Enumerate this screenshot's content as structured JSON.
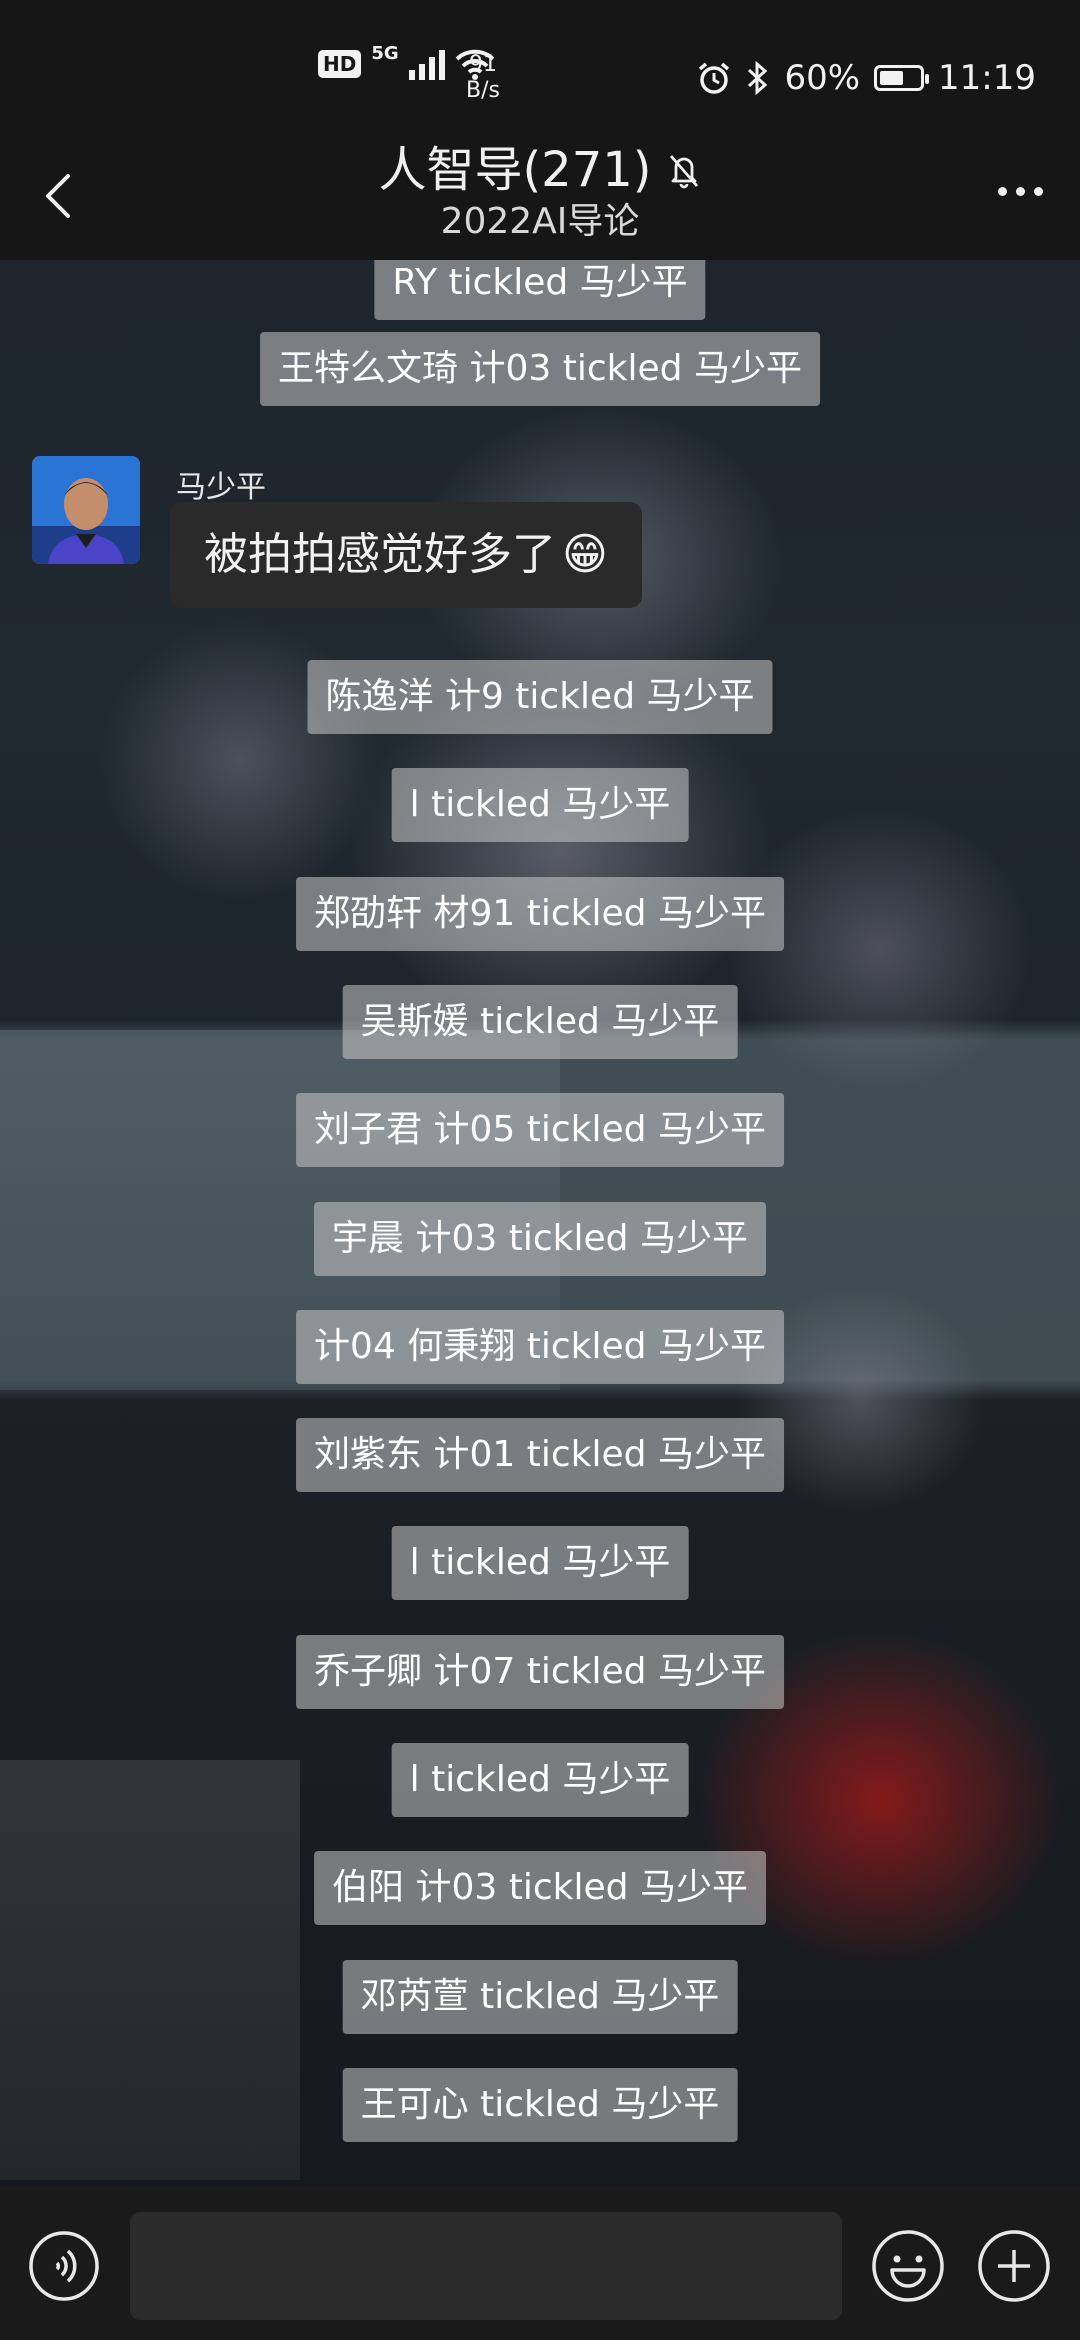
{
  "status_bar": {
    "hd": "HD",
    "network": "5G",
    "net_speed_value": "91",
    "net_speed_unit": "B/s",
    "battery_percent": "60%",
    "battery_level": 0.6,
    "time": "11:19",
    "icons": [
      "signal-icon",
      "wifi-icon",
      "alarm-icon",
      "bluetooth-icon",
      "battery-icon"
    ]
  },
  "header": {
    "title": "人智导(271)",
    "subtitle": "2022AI导论",
    "icons": [
      "back-icon",
      "mute-bell-icon",
      "more-icon"
    ]
  },
  "messages": {
    "top_partial": "RY tickled 马少平",
    "sys_1": "王特么文琦 计03 tickled 马少平",
    "sender_name": "马少平",
    "bubble_text": "被拍拍感觉好多了",
    "bubble_emoji": "😁",
    "list": [
      "陈逸洋 计9 tickled 马少平",
      "l tickled 马少平",
      "郑劭轩 材91 tickled 马少平",
      "吴斯媛 tickled 马少平",
      "刘子君 计05 tickled 马少平",
      "宇晨 计03 tickled 马少平",
      "计04 何秉翔 tickled 马少平",
      "刘紫东 计01 tickled 马少平",
      "l tickled 马少平",
      "乔子卿 计07 tickled 马少平",
      "l tickled 马少平",
      "伯阳 计03 tickled 马少平",
      "邓芮萱 tickled 马少平",
      "王可心 tickled 马少平"
    ]
  },
  "input_bar": {
    "placeholder": "",
    "icons": [
      "voice-icon",
      "emoji-icon",
      "plus-icon"
    ]
  }
}
